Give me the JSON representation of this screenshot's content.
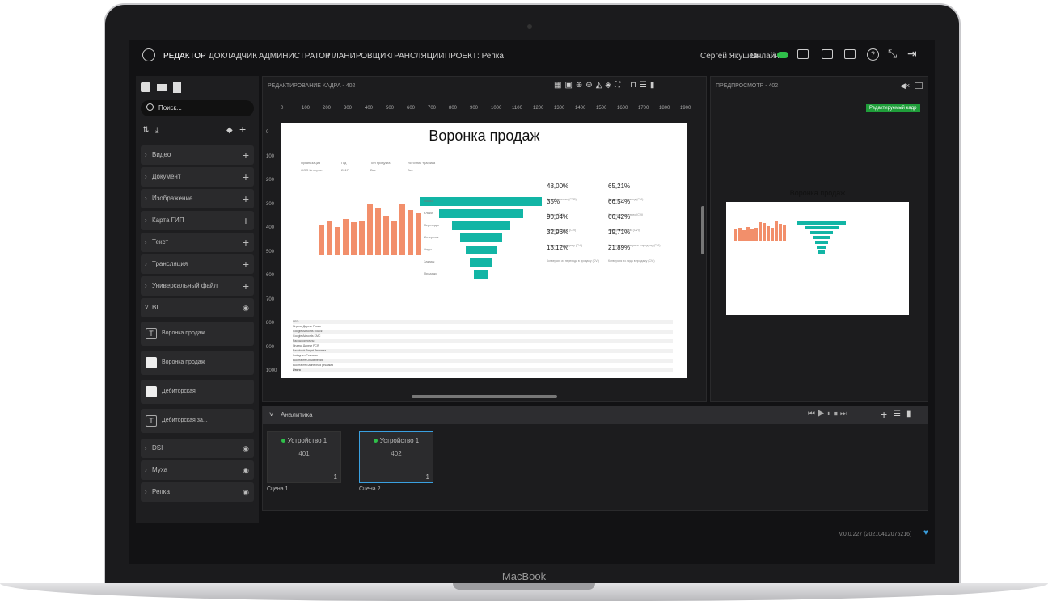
{
  "nav": {
    "items": [
      "РЕДАКТОР",
      "ДОКЛАДЧИК",
      "АДМИНИСТРАТОР",
      "ПЛАНИРОВЩИК",
      "ТРАНСЛЯЦИИ",
      "ПРОЕКТ: Репка"
    ],
    "user": "Сергей Якушев",
    "status": "Онлайн"
  },
  "sidebar": {
    "search_placeholder": "Поиск...",
    "categories": [
      "Видео",
      "Документ",
      "Изображение",
      "Карта ГИП",
      "Текст",
      "Трансляция",
      "Универсальный файл"
    ],
    "bi_label": "BI",
    "bi_items": [
      "Воронка продаж",
      "Воронка продаж",
      "Дебиторская",
      "Дебиторская за..."
    ],
    "groups": [
      "DSI",
      "Муха",
      "Репка"
    ]
  },
  "editor": {
    "title": "РЕДАКТИРОВАНИЕ КАДРА - 402",
    "ruler_x": [
      "0",
      "100",
      "200",
      "300",
      "400",
      "500",
      "600",
      "700",
      "800",
      "900",
      "1000",
      "1100",
      "1200",
      "1300",
      "1400",
      "1500",
      "1600",
      "1700",
      "1800",
      "1900"
    ],
    "ruler_y": [
      "0",
      "100",
      "200",
      "300",
      "400",
      "500",
      "600",
      "700",
      "800",
      "900",
      "1000"
    ]
  },
  "slide": {
    "title": "Воронка продаж",
    "filters": [
      "Организация",
      "Год",
      "Тип продукта",
      "Источник трафика"
    ],
    "filter_values": [
      "ООО Интернет",
      "2017",
      "Все",
      "Все"
    ],
    "funnel_labels": [
      "Показ",
      "Клики",
      "Переходы",
      "Интересы",
      "Лиды",
      "Заказы",
      "Продажи"
    ],
    "kpis_left": [
      {
        "value": "48,00%",
        "label": "Кликабельность (CTR)"
      },
      {
        "value": "35%",
        "label": "Отказы (CVI)"
      },
      {
        "value": "90,04%",
        "label": "Конверсия в лид (CVI)"
      },
      {
        "value": "32,96%",
        "label": "Конверсия в продажу (CVI)"
      },
      {
        "value": "13,12%",
        "label": "Конверсия из перехода в продажу (CVI)"
      }
    ],
    "kpis_right": [
      {
        "value": "65,21%",
        "label": "Конверсия в переход (CVI)"
      },
      {
        "value": "66,54%",
        "label": "Конверсия в интерес (CVI)"
      },
      {
        "value": "66,42%",
        "label": "Конверсия в заказ (CVI)"
      },
      {
        "value": "19,71%",
        "label": "Конверсия из интереса в продажу (CVI)"
      },
      {
        "value": "21,89%",
        "label": "Конверсия из лида в продажу (CVI)"
      }
    ],
    "table_rows": [
      "SEO",
      "Яндекс Директ Поиск",
      "Google Adwords Поиск",
      "Google Adwords KMC",
      "Рассылки почты",
      "Яндекс Директ РСЯ",
      "Facebook Target Реклама",
      "Instagram Реклама",
      "Вконтакте Объявления",
      "Вконтакте Баннерная реклама",
      "Итого"
    ]
  },
  "preview": {
    "title": "ПРЕДПРОСМОТР - 402",
    "badge": "Редактируемый кадр",
    "slide_title": "Воронка продаж"
  },
  "analytics": {
    "title": "Аналитика",
    "scenes": [
      {
        "device": "Устройство 1",
        "number": "401",
        "count": "1",
        "label": "Сцена 1"
      },
      {
        "device": "Устройство 1",
        "number": "402",
        "count": "1",
        "label": "Сцена 2"
      }
    ]
  },
  "footer": {
    "version": "v.0.0.227 (20210412075216)"
  },
  "device_label": "MacBook",
  "colors": {
    "accent": "#12b5a5",
    "bar": "#f28f6b",
    "online": "#2fbf4a",
    "badge": "#1f9e3a"
  }
}
